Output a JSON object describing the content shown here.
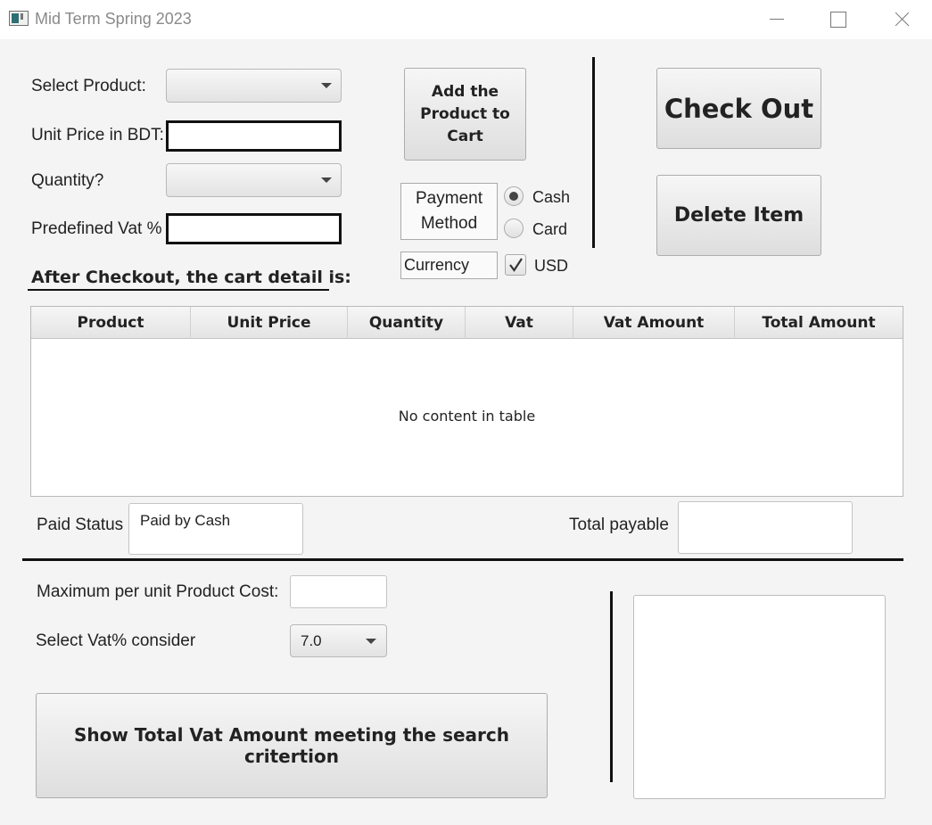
{
  "window": {
    "title": "Mid Term Spring 2023"
  },
  "form": {
    "select_product_label": "Select Product:",
    "unit_price_label": "Unit Price in BDT:",
    "quantity_label": "Quantity?",
    "vat_label": "Predefined Vat %",
    "cart_heading": "After Checkout, the cart detail is:"
  },
  "buttons": {
    "add_to_cart": "Add the Product to Cart",
    "check_out": "Check Out",
    "delete_item": "Delete Item",
    "show_total_vat": "Show Total Vat Amount meeting the search critertion"
  },
  "payment": {
    "method_label": "Payment Method",
    "cash": "Cash",
    "card": "Card",
    "selected": "Cash",
    "currency_label": "Currency",
    "usd": "USD",
    "usd_checked": true
  },
  "table": {
    "columns": [
      "Product",
      "Unit Price",
      "Quantity",
      "Vat",
      "Vat Amount",
      "Total Amount"
    ],
    "empty_text": "No content in table"
  },
  "status": {
    "paid_status_label": "Paid Status",
    "paid_status_value": "Paid by Cash",
    "total_payable_label": "Total payable"
  },
  "search": {
    "max_cost_label": "Maximum per unit Product Cost:",
    "vat_consider_label": "Select Vat% consider",
    "vat_consider_value": "7.0"
  },
  "icons": {
    "radio_selected": "radio-dot",
    "checkbox": "checkmark-icon"
  },
  "colors": {
    "window_bg": "#f4f4f4",
    "button_bg": "#e6e6e6",
    "border_dark": "#111111"
  }
}
